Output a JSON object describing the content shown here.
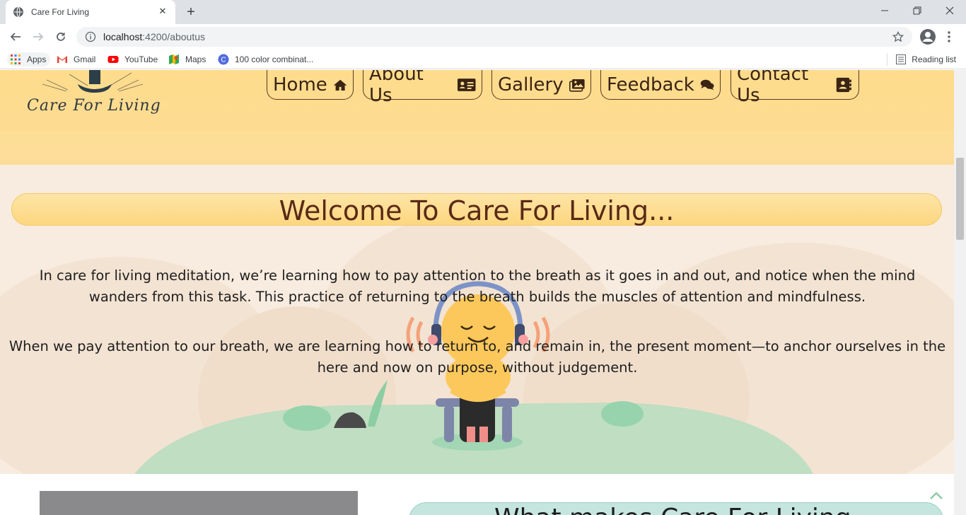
{
  "browser": {
    "tab_title": "Care For Living",
    "url_host": "localhost",
    "url_path": ":4200/aboutus",
    "bookmarks": [
      {
        "label": "Apps",
        "icon": "apps-grid-icon"
      },
      {
        "label": "Gmail",
        "icon": "gmail-icon"
      },
      {
        "label": "YouTube",
        "icon": "youtube-icon"
      },
      {
        "label": "Maps",
        "icon": "maps-icon"
      },
      {
        "label": "100 color combinat...",
        "icon": "bookmark-c-icon"
      }
    ],
    "reading_list": "Reading list"
  },
  "site": {
    "logo_text": "Care For Living",
    "nav": [
      {
        "label": "Home",
        "icon": "home-icon"
      },
      {
        "label": "About Us",
        "icon": "id-card-icon"
      },
      {
        "label": "Gallery",
        "icon": "images-icon"
      },
      {
        "label": "Feedback",
        "icon": "comments-icon"
      },
      {
        "label": "Contact Us",
        "icon": "address-book-icon"
      }
    ]
  },
  "hero": {
    "heading": "Welcome To Care For Living...",
    "paragraph_1": "In care for living meditation, we’re learning how to pay attention to the breath as it goes in and out, and notice when the mind wanders from this task. This practice of returning to the breath builds the muscles of attention and mindfulness.",
    "paragraph_2": "When we pay attention to our breath, we are learning how to return to, and remain in, the present moment—to anchor ourselves in the here and now on purpose, without judgement."
  },
  "section2": {
    "heading": "What makes Care For Living"
  },
  "colors": {
    "header_yellow": "#fedc8c",
    "hero_bg": "#f8ece0",
    "heading_brown": "#5a2a16",
    "teal_pill": "#c5e6df",
    "grass": "#bfdec2"
  }
}
